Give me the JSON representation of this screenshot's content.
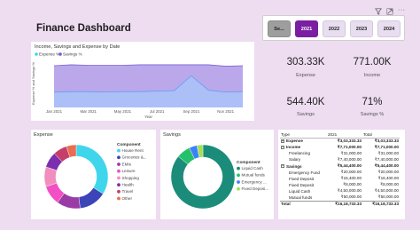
{
  "title": "Finance Dashboard",
  "toolbar": {
    "filter_icon": "filter-icon",
    "expand_icon": "expand-icon",
    "more_label": "···"
  },
  "slicer": {
    "options": [
      "Se...",
      "2021",
      "2022",
      "2023",
      "2024"
    ],
    "selected": "2021"
  },
  "kpis": [
    {
      "value": "303.33K",
      "label": "Expense"
    },
    {
      "value": "771.00K",
      "label": "Income"
    },
    {
      "value": "544.40K",
      "label": "Savings"
    },
    {
      "value": "71%",
      "label": "Savings %"
    }
  ],
  "colors": {
    "background": "#eedcf0",
    "accent": "#7a1fa2",
    "expense_area": "#a9bcf7",
    "savings_area": "#b6a3ea"
  },
  "chart_data": [
    {
      "type": "area",
      "title": "Income, Savings and Expense by Date",
      "xlabel": "Year",
      "ylabel": "Expense % and Savings %",
      "x": [
        "Jan 2021",
        "Feb 2021",
        "Mar 2021",
        "Apr 2021",
        "May 2021",
        "Jun 2021",
        "Jul 2021",
        "Aug 2021",
        "Sep 2021",
        "Oct 2021",
        "Nov 2021",
        "Dec 2021"
      ],
      "xtick_labels": [
        "Jan 2021",
        "Mar 2021",
        "May 2021",
        "Jul 2021",
        "Sep 2021",
        "Nov 2021"
      ],
      "stacked": true,
      "ylim": [
        0,
        1
      ],
      "series": [
        {
          "name": "Expense %",
          "values": [
            0.32,
            0.33,
            0.33,
            0.32,
            0.33,
            0.33,
            0.34,
            0.35,
            0.66,
            0.36,
            0.32,
            0.33
          ]
        },
        {
          "name": "Savings %",
          "values": [
            0.55,
            0.56,
            0.55,
            0.56,
            0.55,
            0.56,
            0.55,
            0.54,
            0.23,
            0.53,
            0.54,
            0.54
          ]
        }
      ],
      "legend": "top-left"
    },
    {
      "type": "pie",
      "title": "Expense",
      "legend_title": "Component",
      "donut": true,
      "categories": [
        "House Rent",
        "Groceries &...",
        "EMIs",
        "Leisure",
        "Shopping",
        "Health",
        "Travel",
        "Other"
      ],
      "values": [
        0.34,
        0.14,
        0.12,
        0.1,
        0.1,
        0.08,
        0.07,
        0.05
      ],
      "colors": [
        "#3fd6ec",
        "#3c44b8",
        "#9a3ba6",
        "#f24fc4",
        "#f08fbd",
        "#7b2fb0",
        "#c63e6a",
        "#e96e51"
      ],
      "legend": "right"
    },
    {
      "type": "pie",
      "title": "Savings",
      "legend_title": "Component",
      "donut": true,
      "categories": [
        "Liquid Cash",
        "Mutual funds",
        "Emergency ...",
        "Fixed Deposi..."
      ],
      "values": [
        0.86,
        0.07,
        0.04,
        0.03
      ],
      "colors": [
        "#1b8c7a",
        "#23c26a",
        "#3b82f6",
        "#a3e05b"
      ],
      "legend": "right"
    },
    {
      "type": "table",
      "columns": [
        "Type",
        "2021",
        "Total"
      ],
      "rows": [
        {
          "type": "Expense",
          "level": 0,
          "expanded": true,
          "y2021": "₹3,03,333.33",
          "total": "₹3,03,333.33"
        },
        {
          "type": "Income",
          "level": 0,
          "expanded": false,
          "y2021": "₹7,71,000.00",
          "total": "₹7,71,000.00"
        },
        {
          "type": "Freelancing",
          "level": 1,
          "y2021": "₹31,000.00",
          "total": "₹31,000.00"
        },
        {
          "type": "Salary",
          "level": 1,
          "y2021": "₹7,40,000.00",
          "total": "₹7,40,000.00"
        },
        {
          "type": "Savings",
          "level": 0,
          "expanded": false,
          "y2021": "₹5,44,400.00",
          "total": "₹5,44,400.00"
        },
        {
          "type": "Emergency Fund",
          "level": 1,
          "y2021": "₹20,000.00",
          "total": "₹20,000.00"
        },
        {
          "type": "Fixed Deposit",
          "level": 1,
          "y2021": "₹16,400.00",
          "total": "₹16,400.00"
        },
        {
          "type": "Fixed Deposit",
          "level": 1,
          "y2021": "₹8,000.00",
          "total": "₹8,000.00"
        },
        {
          "type": "Liquid Cash",
          "level": 1,
          "y2021": "₹4,50,000.00",
          "total": "₹4,50,000.00"
        },
        {
          "type": "Mutual funds",
          "level": 1,
          "y2021": "₹50,000.00",
          "total": "₹50,000.00"
        },
        {
          "type": "Total",
          "level": 0,
          "total_row": true,
          "y2021": "₹16,18,733.33",
          "total": "₹16,18,733.33"
        }
      ]
    }
  ]
}
